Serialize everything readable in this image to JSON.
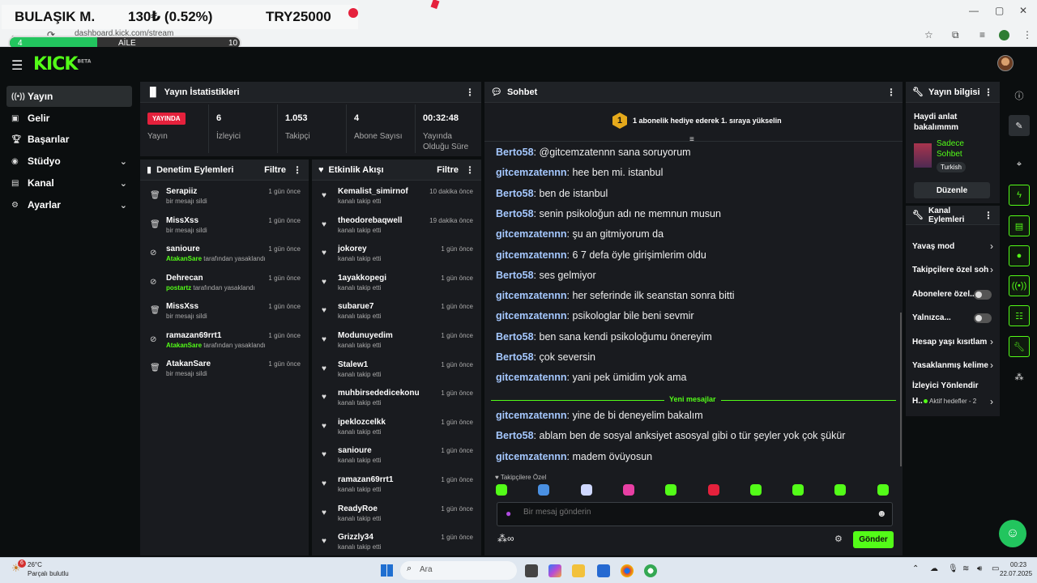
{
  "ticker": {
    "symbol": "BULAŞIK M.",
    "price": "130₺ (0.52%)",
    "total": "TRY25000"
  },
  "progress": {
    "start": "4",
    "label": "AİLE",
    "end": "10",
    "fill_fraction": 0.38
  },
  "browser": {
    "url": "dashboard.kick.com/stream"
  },
  "brand": {
    "logo": "KICK",
    "tag": "BETA",
    "accent": "#53fc18"
  },
  "sidebar": {
    "items": [
      {
        "label": "Yayın",
        "icon": "broadcast-icon",
        "active": true
      },
      {
        "label": "Gelir",
        "icon": "revenue-icon"
      },
      {
        "label": "Başarılar",
        "icon": "trophy-icon"
      },
      {
        "label": "Stüdyo",
        "icon": "studio-icon",
        "chevron": true
      },
      {
        "label": "Kanal",
        "icon": "channel-icon",
        "chevron": true
      },
      {
        "label": "Ayarlar",
        "icon": "gear-icon",
        "chevron": true
      }
    ]
  },
  "stats": {
    "title": "Yayın İstatistikleri",
    "live_badge": "YAYINDA",
    "live_label": "Yayın",
    "items": [
      {
        "value": "6",
        "label": "İzleyici"
      },
      {
        "value": "1.053",
        "label": "Takipçi"
      },
      {
        "value": "4",
        "label": "Abone Sayısı"
      },
      {
        "value": "00:32:48",
        "label": "Yayında Olduğu Süre"
      }
    ]
  },
  "moderation": {
    "title": "Denetim Eylemleri",
    "filter": "Filtre",
    "rows": [
      {
        "name": "Serapiiz",
        "sub": "bir mesajı sildi",
        "time": "1 gün önce",
        "icon": "trash"
      },
      {
        "name": "MissXss",
        "sub": "bir mesajı sildi",
        "time": "1 gün önce",
        "icon": "trash"
      },
      {
        "name": "sanioure",
        "by": "AtakanSare",
        "sub": "tarafından yasaklandı",
        "time": "1 gün önce",
        "icon": "ban"
      },
      {
        "name": "Dehrecan",
        "by": "postartz",
        "sub": "tarafından yasaklandı",
        "time": "1 gün önce",
        "icon": "ban"
      },
      {
        "name": "MissXss",
        "sub": "bir mesajı sildi",
        "time": "1 gün önce",
        "icon": "trash"
      },
      {
        "name": "ramazan69rrt1",
        "by": "AtakanSare",
        "sub": "tarafından yasaklandı",
        "time": "1 gün önce",
        "icon": "ban"
      },
      {
        "name": "AtakanSare",
        "sub": "bir mesajı sildi",
        "time": "1 gün önce",
        "icon": "trash"
      }
    ]
  },
  "activity": {
    "title": "Etkinlik Akışı",
    "filter": "Filtre",
    "rows": [
      {
        "name": "Kemalist_simirnof",
        "sub": "kanalı takip etti",
        "time": "10 dakika önce"
      },
      {
        "name": "theodorebaqwell",
        "sub": "kanalı takip etti",
        "time": "19 dakika önce"
      },
      {
        "name": "jokorey",
        "sub": "kanalı takip etti",
        "time": "1 gün önce"
      },
      {
        "name": "1ayakkopegi",
        "sub": "kanalı takip etti",
        "time": "1 gün önce"
      },
      {
        "name": "subarue7",
        "sub": "kanalı takip etti",
        "time": "1 gün önce"
      },
      {
        "name": "Modunuyedim",
        "sub": "kanalı takip etti",
        "time": "1 gün önce"
      },
      {
        "name": "Stalew1",
        "sub": "kanalı takip etti",
        "time": "1 gün önce"
      },
      {
        "name": "muhbirsededicekonu",
        "sub": "kanalı takip etti",
        "time": "1 gün önce"
      },
      {
        "name": "ipeklozcelkk",
        "sub": "kanalı takip etti",
        "time": "1 gün önce"
      },
      {
        "name": "sanioure",
        "sub": "kanalı takip etti",
        "time": "1 gün önce"
      },
      {
        "name": "ramazan69rrt1",
        "sub": "kanalı takip etti",
        "time": "1 gün önce"
      },
      {
        "name": "ReadyRoe",
        "sub": "kanalı takip etti",
        "time": "1 gün önce"
      },
      {
        "name": "Grizzly34",
        "sub": "kanalı takip etti",
        "time": "1 gün önce"
      }
    ]
  },
  "chat": {
    "title": "Sohbet",
    "pinned_rank": "1",
    "pinned": "1 abonelik hediye ederek 1. sıraya yükselin",
    "messages": [
      {
        "user": "Berto58",
        "text": "@gitcemzatennn sana soruyorum"
      },
      {
        "user": "gitcemzatennn",
        "text": "hee ben mi. istanbul"
      },
      {
        "user": "Berto58",
        "text": "ben de istanbul"
      },
      {
        "user": "Berto58",
        "text": "senin psikoloğun adı ne memnun musun"
      },
      {
        "user": "gitcemzatennn",
        "text": "şu an gitmiyorum da"
      },
      {
        "user": "gitcemzatennn",
        "text": "6 7 defa öyle girişimlerim oldu"
      },
      {
        "user": "Berto58",
        "text": "ses gelmiyor"
      },
      {
        "user": "gitcemzatennn",
        "text": "her seferinde ilk seanstan sonra bitti"
      },
      {
        "user": "gitcemzatennn",
        "text": "psikologlar bile beni sevmir"
      },
      {
        "user": "Berto58",
        "text": "ben sana kendi psikoloğumu önereyim"
      },
      {
        "user": "Berto58",
        "text": "çok seversin"
      },
      {
        "user": "gitcemzatennn",
        "text": "yani pek ümidim yok ama"
      }
    ],
    "new_label": "Yeni mesajlar",
    "new_messages": [
      {
        "user": "gitcemzatennn",
        "text": "yine de bi deneyelim bakalım"
      },
      {
        "user": "Berto58",
        "text": "ablam ben de sosyal anksiyet asosyal gibi o tür şeyler yok çok şükür"
      },
      {
        "user": "gitcemzatennn",
        "text": "madem övüyosun"
      }
    ],
    "followers_only": "Takipçilere Özel",
    "emotes": [
      "#53fc18",
      "#4a90e2",
      "#cfd8ff",
      "#e83fa3",
      "#53fc18",
      "#e5213c",
      "#53fc18",
      "#53fc18",
      "#53fc18",
      "#53fc18"
    ],
    "placeholder": "Bir mesaj gönderin",
    "send": "Gönder"
  },
  "stream_info": {
    "title": "Yayın bilgisi",
    "stream_title": "Haydi anlat bakalımmm",
    "category": "Sadece Sohbet",
    "language": "Turkish",
    "edit": "Düzenle"
  },
  "channel_actions": {
    "title": "Kanal Eylemleri",
    "items": [
      {
        "label": "Yavaş mod",
        "control": "chevron"
      },
      {
        "label": "Takipçilere özel soh",
        "control": "chevron"
      },
      {
        "label": "Abonelere özel...",
        "control": "toggle"
      },
      {
        "label": "Yalnızca...",
        "control": "toggle"
      },
      {
        "label": "Hesap yaşı kısıtlam",
        "control": "chevron"
      },
      {
        "label": "Yasaklanmış kelime",
        "control": "chevron"
      },
      {
        "label": "İzleyici Yönlendir",
        "control": "none"
      }
    ],
    "goal_prefix": "H..",
    "goal_text": "Aktif hedefler - 2"
  },
  "taskbar": {
    "temp": "26°C",
    "weather": "Parçalı bulutlu",
    "weather_badge": "6",
    "search": "Ara",
    "time": "00:23",
    "date": "22.07.2025"
  }
}
